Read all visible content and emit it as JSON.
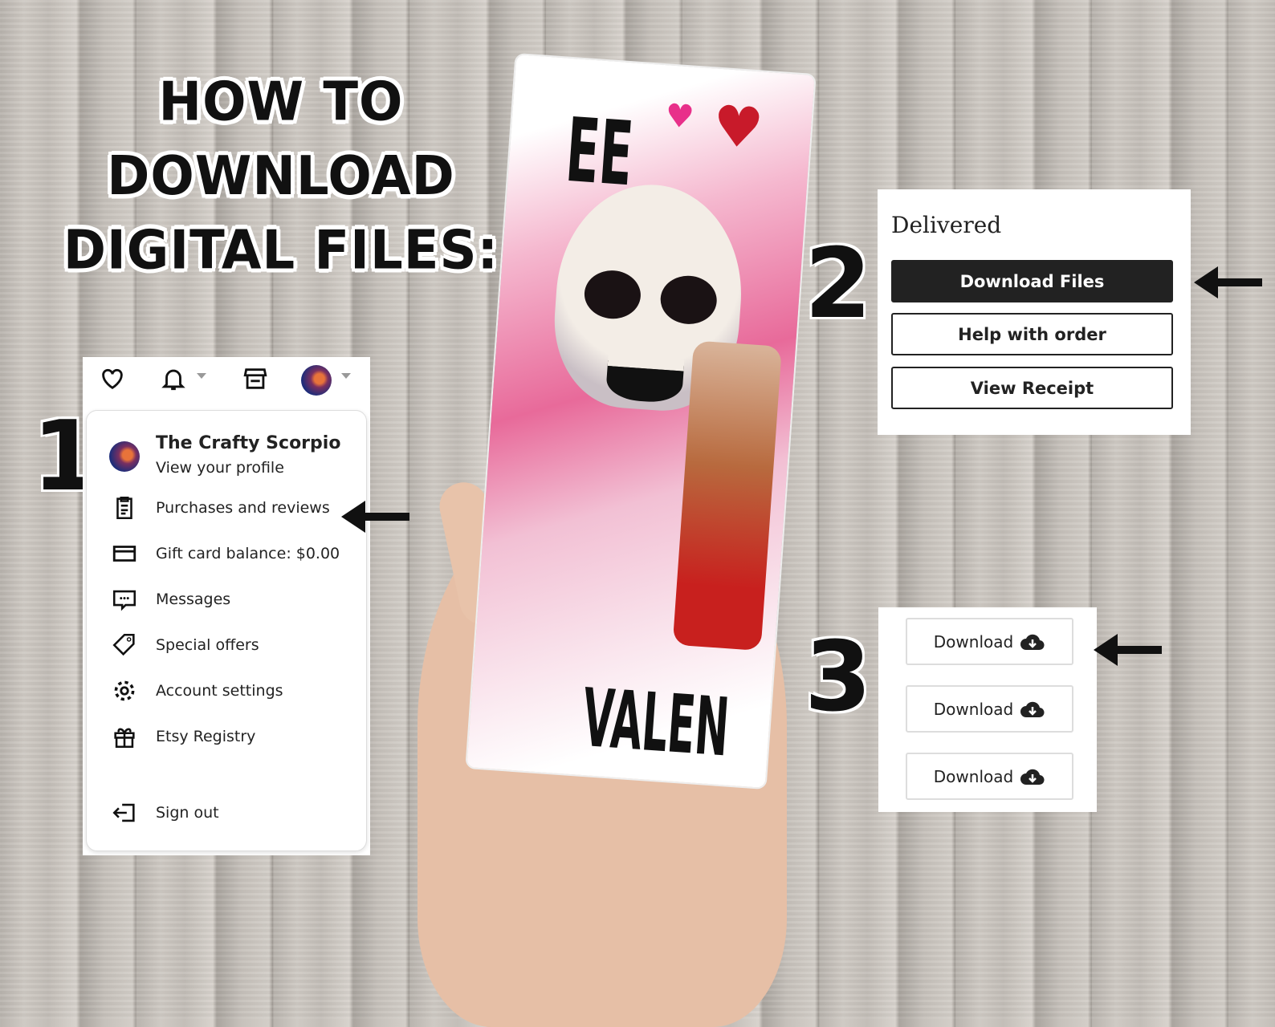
{
  "heading": {
    "line1": "HOW TO DOWNLOAD",
    "line2": "DIGITAL FILES:"
  },
  "steps": [
    "1",
    "2",
    "3"
  ],
  "step1": {
    "topbar_icons": [
      "heart-icon",
      "bell-icon",
      "shop-icon",
      "avatar"
    ],
    "profile_name": "The Crafty Scorpio",
    "profile_link": "View your profile",
    "items": [
      {
        "icon": "clipboard-icon",
        "label": "Purchases and reviews"
      },
      {
        "icon": "credit-card-icon",
        "label": "Gift card balance: $0.00"
      },
      {
        "icon": "message-icon",
        "label": "Messages"
      },
      {
        "icon": "tag-icon",
        "label": "Special offers"
      },
      {
        "icon": "gear-icon",
        "label": "Account settings"
      },
      {
        "icon": "gift-icon",
        "label": "Etsy Registry"
      },
      {
        "icon": "sign-out-icon",
        "label": "Sign out"
      }
    ]
  },
  "step2": {
    "status": "Delivered",
    "buttons": [
      "Download Files",
      "Help with order",
      "View Receipt"
    ]
  },
  "step3": {
    "buttons": [
      "Download",
      "Download",
      "Download"
    ]
  },
  "product": {
    "text_top": "EE",
    "text_bottom": "VALEN"
  },
  "colors": {
    "primary_button": "#222222",
    "text": "#222222"
  }
}
